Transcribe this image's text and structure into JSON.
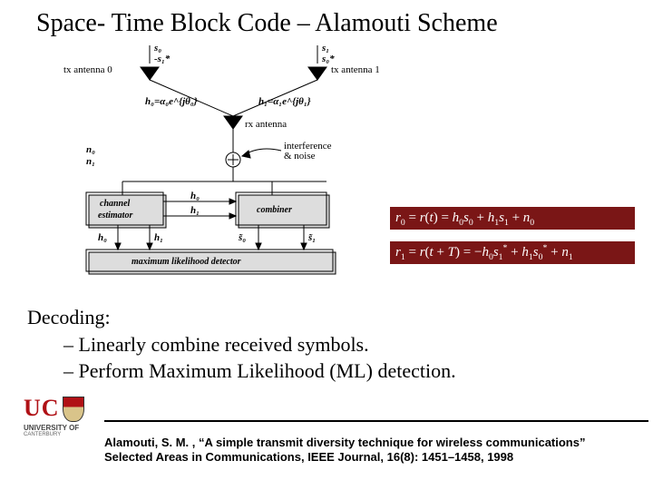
{
  "title": "Space- Time Block Code – Alamouti Scheme",
  "diagram": {
    "tx0_label": "tx antenna 0",
    "tx1_label": "tx antenna 1",
    "rx_label": "rx antenna",
    "tx0_sym_a": "s₀",
    "tx0_sym_b": "-s₁*",
    "tx1_sym_a": "s₁",
    "tx1_sym_b": "s₀*",
    "h0": "h₀=α₀e^{jθ₀}",
    "h1": "h₁=α₁e^{jθ₁}",
    "n0": "n₀",
    "n1": "n₁",
    "interf": "interference",
    "noise": "& noise",
    "ch_est": "channel",
    "ch_est2": "estimator",
    "combiner": "combiner",
    "ml": "maximum likelihood detector",
    "h0s": "h₀",
    "h1s": "h₁",
    "s0tilde": "s̃₀",
    "s1tilde": "s̃₁"
  },
  "equations": {
    "r0": "r₀ = r(t) = h₀s₀ + h₁s₁ + n₀",
    "r1": "r₁ = r(t + T) = −h₀s₁* + h₁s₀* + n₁"
  },
  "decoding": {
    "head": "Decoding:",
    "line1": "– Linearly combine received symbols.",
    "line2": "– Perform Maximum Likelihood (ML) detection."
  },
  "logo": {
    "uc": "UC",
    "sub1": "UNIVERSITY OF",
    "sub2": "CANTERBURY"
  },
  "citation": {
    "l1": "Alamouti, S. M. , “A simple transmit diversity technique for wireless communications”",
    "l2": "Selected Areas in Communications, IEEE Journal, 16(8): 1451–1458, 1998"
  }
}
